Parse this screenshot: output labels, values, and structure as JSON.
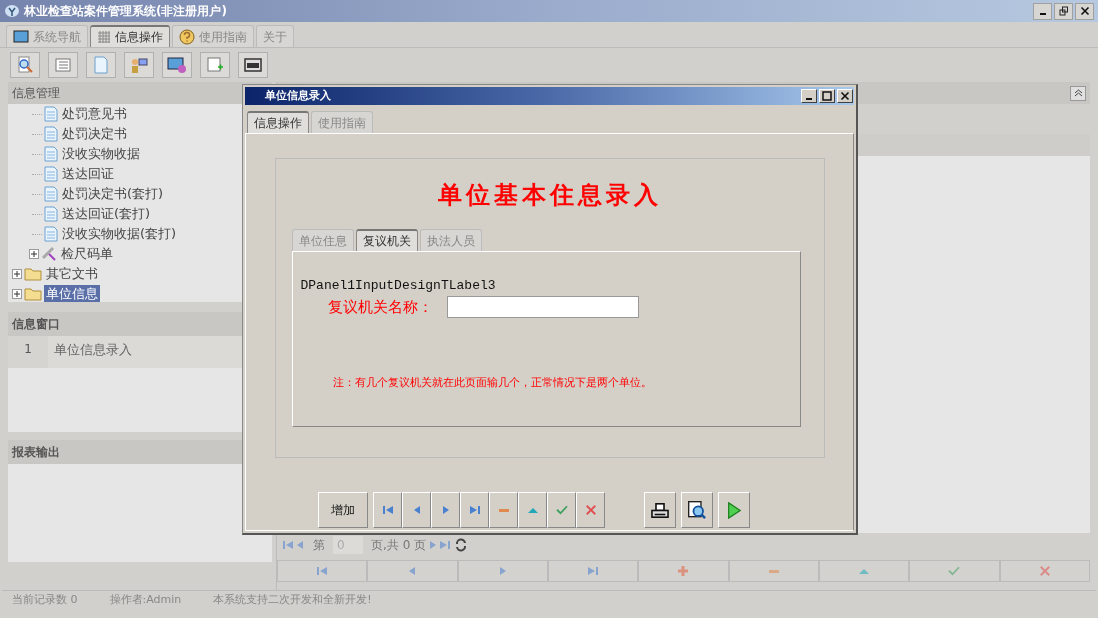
{
  "window": {
    "title": "林业检查站案件管理系统(非注册用户)"
  },
  "tabs": [
    {
      "label": "系统导航",
      "kind": "monitor",
      "selected": false
    },
    {
      "label": "信息操作",
      "kind": "grid",
      "selected": true
    },
    {
      "label": "使用指南",
      "kind": "help",
      "selected": false
    },
    {
      "label": "关于",
      "kind": "plain",
      "selected": false
    }
  ],
  "left_panel": {
    "title": "信息管理",
    "tree": [
      {
        "children": [
          {
            "children": [
              {
                "label": "处罚意见书",
                "kind": "doc",
                "selected": false
              },
              {
                "label": "处罚决定书",
                "kind": "doc",
                "selected": false
              },
              {
                "label": "没收实物收据",
                "kind": "doc",
                "selected": false
              },
              {
                "label": "送达回证",
                "kind": "doc",
                "selected": false
              },
              {
                "label": "处罚决定书(套打)",
                "kind": "doc",
                "selected": false
              },
              {
                "label": "送达回证(套打)",
                "kind": "doc",
                "selected": false
              },
              {
                "label": "没收实物收据(套打)",
                "kind": "doc",
                "selected": false
              }
            ]
          },
          {
            "label": "检尺码单",
            "kind": "tool",
            "expanded": false,
            "selected": false
          }
        ]
      },
      {
        "label": "其它文书",
        "kind": "folder",
        "expanded": false,
        "selected": false
      },
      {
        "label": "单位信息",
        "kind": "folder",
        "expanded": false,
        "selected": true
      }
    ]
  },
  "info_window": {
    "title": "信息窗口",
    "rows": [
      {
        "index": "1",
        "label": "单位信息录入"
      }
    ]
  },
  "report_output": {
    "title": "报表输出"
  },
  "pager": {
    "page_label": "第",
    "page_value": "0",
    "total": "页,共 0 页"
  },
  "grid_buttons": [
    {
      "kind": "first"
    },
    {
      "kind": "prev"
    },
    {
      "kind": "next"
    },
    {
      "kind": "last"
    },
    {
      "kind": "add"
    },
    {
      "kind": "delete"
    },
    {
      "kind": "up"
    },
    {
      "kind": "confirm"
    },
    {
      "kind": "cancel"
    }
  ],
  "status_bar": [
    "当前记录数 0",
    "操作者:Admin",
    "本系统支持二次开发和全新开发!"
  ],
  "dialog": {
    "title": "单位信息录入",
    "tabs": [
      {
        "label": "信息操作",
        "selected": true
      },
      {
        "label": "使用指南",
        "selected": false
      }
    ],
    "heading": "单位基本住息录入",
    "subtabs": [
      {
        "label": "单位住息",
        "selected": false
      },
      {
        "label": "复议机关",
        "selected": true
      },
      {
        "label": "执法人员",
        "selected": false
      }
    ],
    "design_label": "DPanel1InputDesignTLabel3",
    "field": {
      "label": "复议机关名称："
    },
    "note": "注：有几个复议机关就在此页面输几个，正常情况下是两个单位。",
    "buttons": [
      {
        "kind": "text",
        "label": "增加"
      },
      {
        "kind": "first"
      },
      {
        "kind": "prev"
      },
      {
        "kind": "next"
      },
      {
        "kind": "last"
      },
      {
        "kind": "delete"
      },
      {
        "kind": "up"
      },
      {
        "kind": "confirm"
      },
      {
        "kind": "cancel"
      },
      {
        "kind": "print"
      },
      {
        "kind": "preview"
      },
      {
        "kind": "run"
      }
    ]
  }
}
